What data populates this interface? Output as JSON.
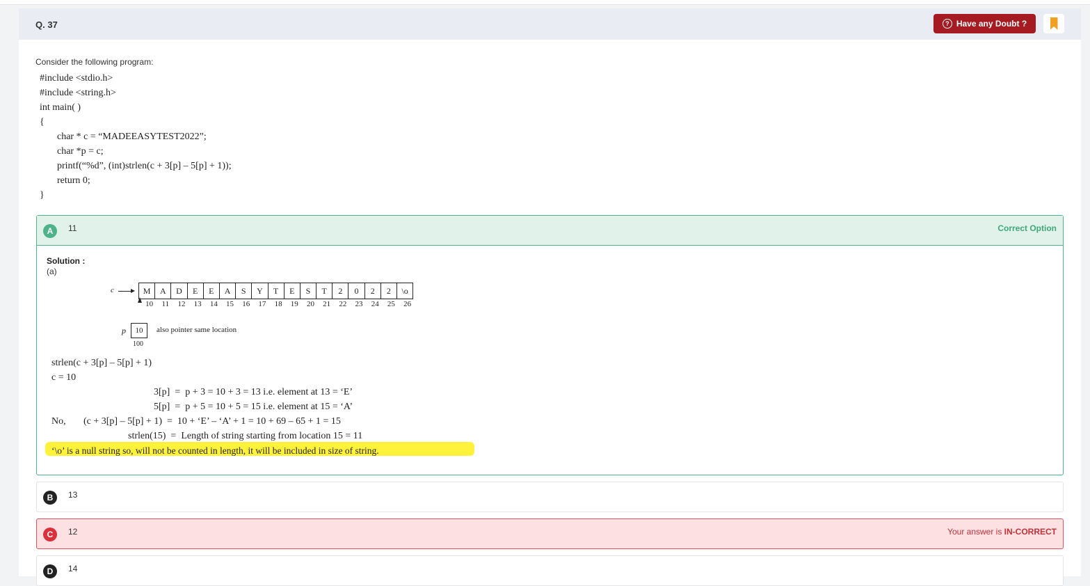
{
  "question": {
    "number": "Q. 37",
    "doubt_button": "Have any Doubt ?",
    "doubt_icon": "question-bubble-icon",
    "bookmark_icon": "bookmark-icon",
    "intro": "Consider the following program:",
    "code": [
      "#include <stdio.h>",
      "#include <string.h>",
      "int main( )",
      "{",
      "char * c = “MADEEASYTEST2022”;",
      "char *p = c;",
      "printf(“%d”, (int)strlen(c + 3[p] – 5[p] + 1));",
      "return 0;",
      "}"
    ]
  },
  "options": [
    {
      "letter": "A",
      "text": "11",
      "status": "Correct Option"
    },
    {
      "letter": "B",
      "text": "13"
    },
    {
      "letter": "C",
      "text": "12",
      "status_prefix": "Your answer is ",
      "status_bold": "IN-CORRECT"
    },
    {
      "letter": "D",
      "text": "14"
    }
  ],
  "solution": {
    "title": "Solution :",
    "sub": "(a)",
    "pointer_label": "c",
    "array_cells": [
      "M",
      "A",
      "D",
      "E",
      "E",
      "A",
      "S",
      "Y",
      "T",
      "E",
      "S",
      "T",
      "2",
      "0",
      "2",
      "2",
      "\\o"
    ],
    "array_indices": [
      "10",
      "11",
      "12",
      "13",
      "14",
      "15",
      "16",
      "17",
      "18",
      "19",
      "20",
      "21",
      "22",
      "23",
      "24",
      "25",
      "26"
    ],
    "p_label": "p",
    "p_value": "10",
    "p_note": "also pointer same location",
    "p_address": "100",
    "lines": {
      "l1": "strlen(c + 3[p] – 5[p] + 1)",
      "l2": "c = 10",
      "l3": "3[p]  =  p + 3 = 10 + 3 = 13 i.e. element at 13 = ‘E’",
      "l4": "5[p]  =  p + 5 = 10 + 5 = 15 i.e. element at 15 = ‘A’",
      "l5a": "No,",
      "l5b": "(c + 3[p] – 5[p] + 1)  =  10 + ‘E’ – ‘A’ + 1 = 10 + 69 – 65 + 1 = 15",
      "l6": "strlen(15)  =  Length of string starting from location 15 = 11",
      "l7": "‘\\o’ is a null string so, will not be counted in length, it will be included in size of string."
    }
  },
  "colors": {
    "doubt_bg": "#a61b22",
    "correct_green": "#4fb389",
    "incorrect_red": "#e0515b",
    "bookmark": "#f2a024",
    "highlight": "#fff23b"
  }
}
